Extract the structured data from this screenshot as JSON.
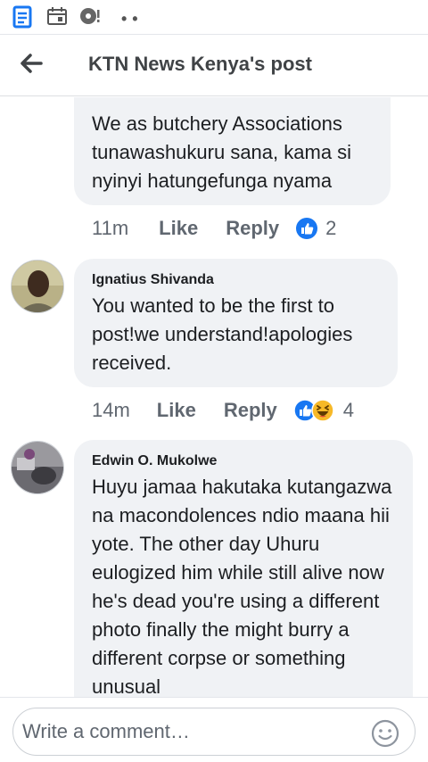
{
  "header": {
    "title": "KTN News Kenya's post"
  },
  "comments": [
    {
      "text": "We as butchery Associations tunawashukuru sana, kama si nyinyi hatungefunga nyama",
      "time": "11m",
      "like_label": "Like",
      "reply_label": "Reply",
      "reactions": [
        "like-icon"
      ],
      "reaction_count": "2"
    },
    {
      "author": "Ignatius Shivanda",
      "text": "You wanted to be the first to post!we understand!apologies received.",
      "time": "14m",
      "like_label": "Like",
      "reply_label": "Reply",
      "reactions": [
        "like-icon",
        "laugh-icon"
      ],
      "reaction_count": "4"
    },
    {
      "author": "Edwin O. Mukolwe",
      "text": "Huyu jamaa hakutaka kutangazwa na macondolences ndio maana hii yote. The other day Uhuru eulogized him while still alive now he's dead you're using a different photo finally the might burry a different corpse or something unusual"
    }
  ],
  "composer": {
    "placeholder": "Write a comment…"
  },
  "colors": {
    "accent": "#1877f2",
    "bubble": "#f0f2f5",
    "muted_text": "#606770"
  }
}
